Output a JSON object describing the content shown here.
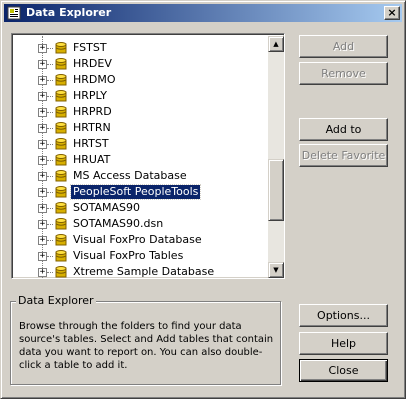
{
  "window": {
    "title": "Data Explorer",
    "close_glyph": "×",
    "icon": "data-explorer-icon"
  },
  "tree": {
    "items": [
      {
        "label": "FSTST",
        "icon": "database-icon",
        "expander": "+"
      },
      {
        "label": "HRDEV",
        "icon": "database-icon",
        "expander": "+"
      },
      {
        "label": "HRDMO",
        "icon": "database-icon",
        "expander": "+"
      },
      {
        "label": "HRPLY",
        "icon": "database-icon",
        "expander": "+"
      },
      {
        "label": "HRPRD",
        "icon": "database-icon",
        "expander": "+"
      },
      {
        "label": "HRTRN",
        "icon": "database-icon",
        "expander": "+"
      },
      {
        "label": "HRTST",
        "icon": "database-icon",
        "expander": "+"
      },
      {
        "label": "HRUAT",
        "icon": "database-icon",
        "expander": "+"
      },
      {
        "label": "MS Access Database",
        "icon": "database-icon",
        "expander": "+"
      },
      {
        "label": "PeopleSoft PeopleTools",
        "icon": "database-icon",
        "expander": "+",
        "selected": true
      },
      {
        "label": "SOTAMAS90",
        "icon": "database-icon",
        "expander": "+"
      },
      {
        "label": "SOTAMAS90.dsn",
        "icon": "database-icon",
        "expander": "+"
      },
      {
        "label": "Visual FoxPro Database",
        "icon": "database-icon",
        "expander": "+"
      },
      {
        "label": "Visual FoxPro Tables",
        "icon": "database-icon",
        "expander": "+"
      },
      {
        "label": "Xtreme Sample Database",
        "icon": "database-icon",
        "expander": "+"
      }
    ],
    "scroll": {
      "up_glyph": "▲",
      "down_glyph": "▼",
      "position_fraction": 0.72
    }
  },
  "buttons": {
    "add": "Add",
    "remove": "Remove",
    "add_to_favorites": "Add to Favorites",
    "delete_favorite": "Delete Favorite",
    "options": "Options...",
    "help": "Help",
    "close": "Close"
  },
  "info": {
    "title": "Data Explorer",
    "text": "Browse through the folders to find your data source's tables.  Select and Add tables that contain data you want to report on.  You can also double-click a table to add it."
  },
  "colors": {
    "face": "#d4d0c8",
    "title_start": "#0a246a",
    "title_end": "#a6caf0",
    "selection": "#0a246a"
  }
}
